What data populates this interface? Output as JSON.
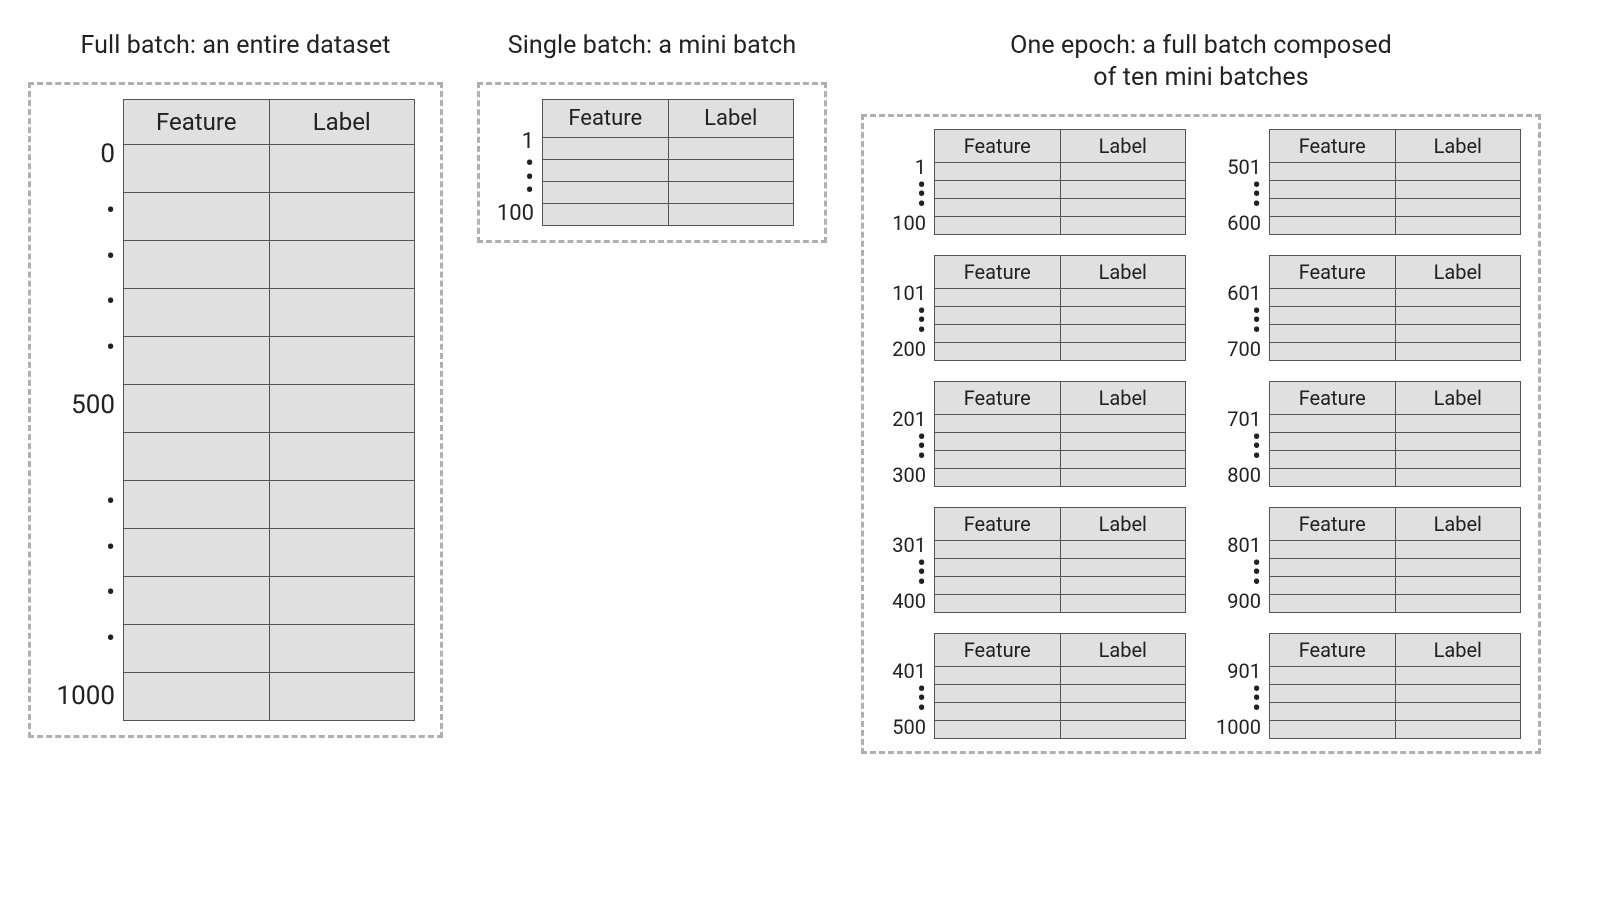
{
  "columns": {
    "feature": "Feature",
    "label": "Label"
  },
  "full": {
    "title": "Full batch: an entire dataset",
    "ticks": [
      "0",
      "•",
      "•",
      "•",
      "•",
      "500",
      "",
      "•",
      "•",
      "•",
      "•",
      "1000"
    ]
  },
  "single": {
    "title": "Single batch: a mini batch",
    "ticks": [
      "1",
      "•",
      "•",
      "•",
      "100"
    ]
  },
  "epoch": {
    "title": "One epoch: a full batch composed\nof ten mini batches",
    "minis": [
      {
        "ticks": [
          "1",
          "•",
          "•",
          "•",
          "100"
        ]
      },
      {
        "ticks": [
          "501",
          "•",
          "•",
          "•",
          "600"
        ]
      },
      {
        "ticks": [
          "101",
          "•",
          "•",
          "•",
          "200"
        ]
      },
      {
        "ticks": [
          "601",
          "•",
          "•",
          "•",
          "700"
        ]
      },
      {
        "ticks": [
          "201",
          "•",
          "•",
          "•",
          "300"
        ]
      },
      {
        "ticks": [
          "701",
          "•",
          "•",
          "•",
          "800"
        ]
      },
      {
        "ticks": [
          "301",
          "•",
          "•",
          "•",
          "400"
        ]
      },
      {
        "ticks": [
          "801",
          "•",
          "•",
          "•",
          "900"
        ]
      },
      {
        "ticks": [
          "401",
          "•",
          "•",
          "•",
          "500"
        ]
      },
      {
        "ticks": [
          "901",
          "•",
          "•",
          "•",
          "1000"
        ]
      }
    ]
  }
}
